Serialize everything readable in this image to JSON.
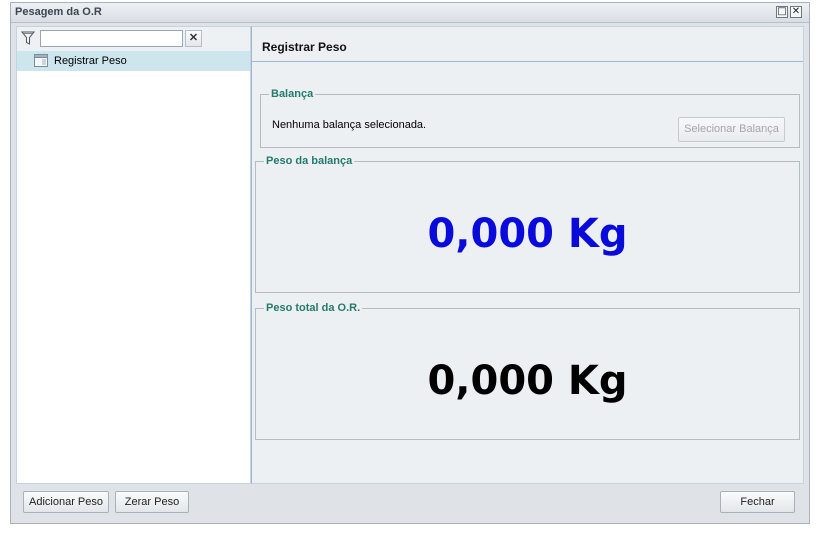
{
  "window": {
    "title": "Pesagem da O.R",
    "maximize_glyph": "□",
    "close_glyph": "✕"
  },
  "sidebar": {
    "filter": {
      "value": "",
      "placeholder": "",
      "clear_glyph": "✕",
      "icon": "filter-icon"
    },
    "items": [
      {
        "label": "Registrar Peso",
        "icon": "form-icon",
        "selected": true
      }
    ]
  },
  "main": {
    "header": "Registrar Peso",
    "balanca": {
      "legend": "Balança",
      "message": "Nenhuma balança selecionada.",
      "select_button": "Selecionar Balança",
      "select_button_enabled": false
    },
    "peso_balanca": {
      "legend": "Peso da balança",
      "value": "0,000 Kg",
      "color": "#0a0adb"
    },
    "peso_total": {
      "legend": "Peso total da O.R.",
      "value": "0,000 Kg",
      "color": "#000000"
    }
  },
  "footer": {
    "add_button": "Adicionar Peso",
    "reset_button": "Zerar Peso",
    "close_button": "Fechar"
  },
  "colors": {
    "legend": "#247a6c",
    "selection": "#cde6ee"
  }
}
